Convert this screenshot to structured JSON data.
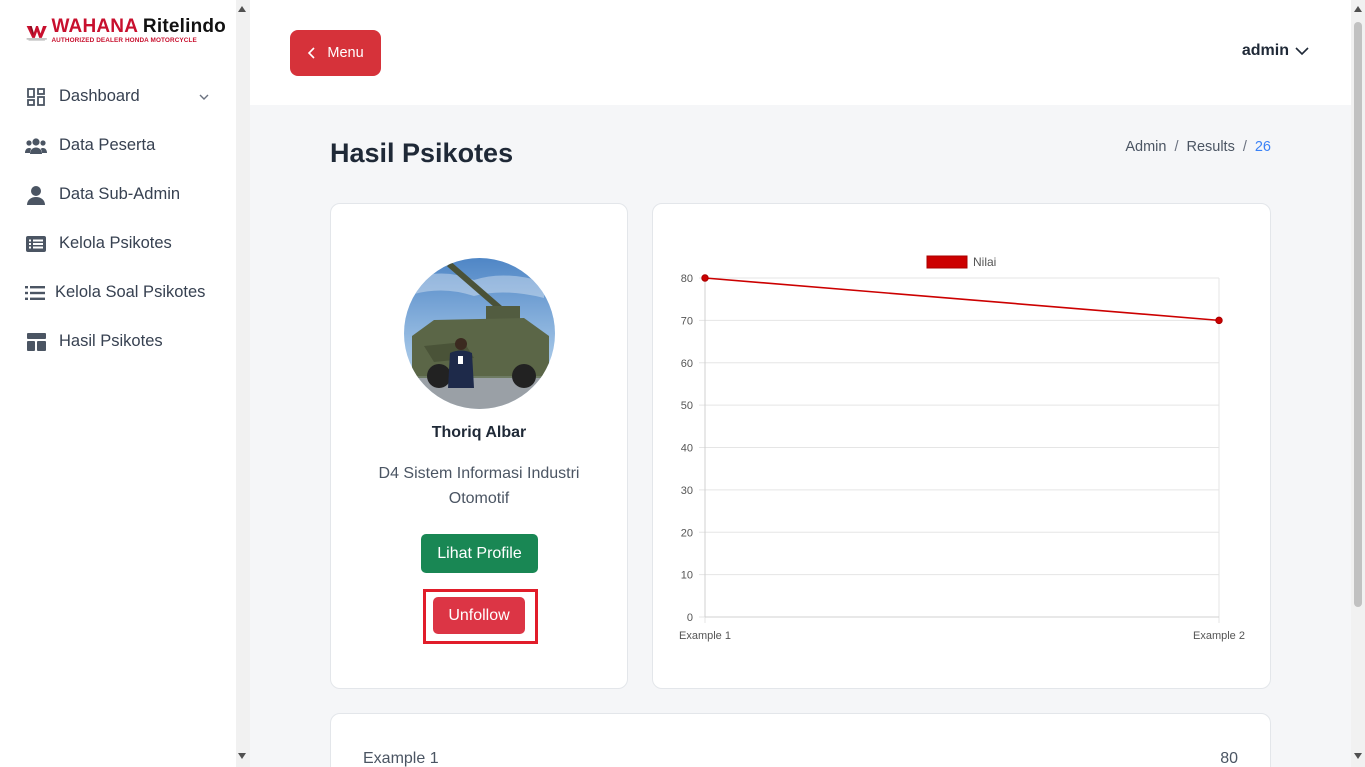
{
  "brand": {
    "name_part1": "WAHANA",
    "name_part2": "Ritelindo",
    "tagline": "AUTHORIZED DEALER HONDA MOTORCYCLE",
    "accent": "#c8102e"
  },
  "sidebar": {
    "items": [
      {
        "label": "Dashboard",
        "icon": "dashboard-icon",
        "has_chevron": true
      },
      {
        "label": "Data Peserta",
        "icon": "users-icon"
      },
      {
        "label": "Data Sub-Admin",
        "icon": "user-icon"
      },
      {
        "label": "Kelola Psikotes",
        "icon": "list-box-icon"
      },
      {
        "label": "Kelola Soal Psikotes",
        "icon": "list-icon"
      },
      {
        "label": "Hasil Psikotes",
        "icon": "layout-icon"
      }
    ]
  },
  "topbar": {
    "menu_label": "Menu",
    "user_label": "admin"
  },
  "page": {
    "title": "Hasil Psikotes",
    "breadcrumb": [
      "Admin",
      "Results",
      "26"
    ]
  },
  "profile": {
    "name": "Thoriq Albar",
    "major": "D4 Sistem Informasi Industri Otomotif",
    "view_button": "Lihat Profile",
    "unfollow_button": "Unfollow"
  },
  "colors": {
    "primary_red": "#dc3545",
    "menu_red": "#d6323a",
    "green": "#198754",
    "link_blue": "#3b82f6"
  },
  "chart_data": {
    "type": "line",
    "categories": [
      "Example 1",
      "Example 2"
    ],
    "series": [
      {
        "name": "Nilai",
        "values": [
          80,
          70
        ],
        "color": "#cc0000"
      }
    ],
    "ylim": [
      0,
      80
    ],
    "yticks": [
      0,
      10,
      20,
      30,
      40,
      50,
      60,
      70,
      80
    ],
    "legend": "top-center",
    "grid": true
  },
  "results_list": [
    {
      "label": "Example 1",
      "value": "80"
    }
  ]
}
